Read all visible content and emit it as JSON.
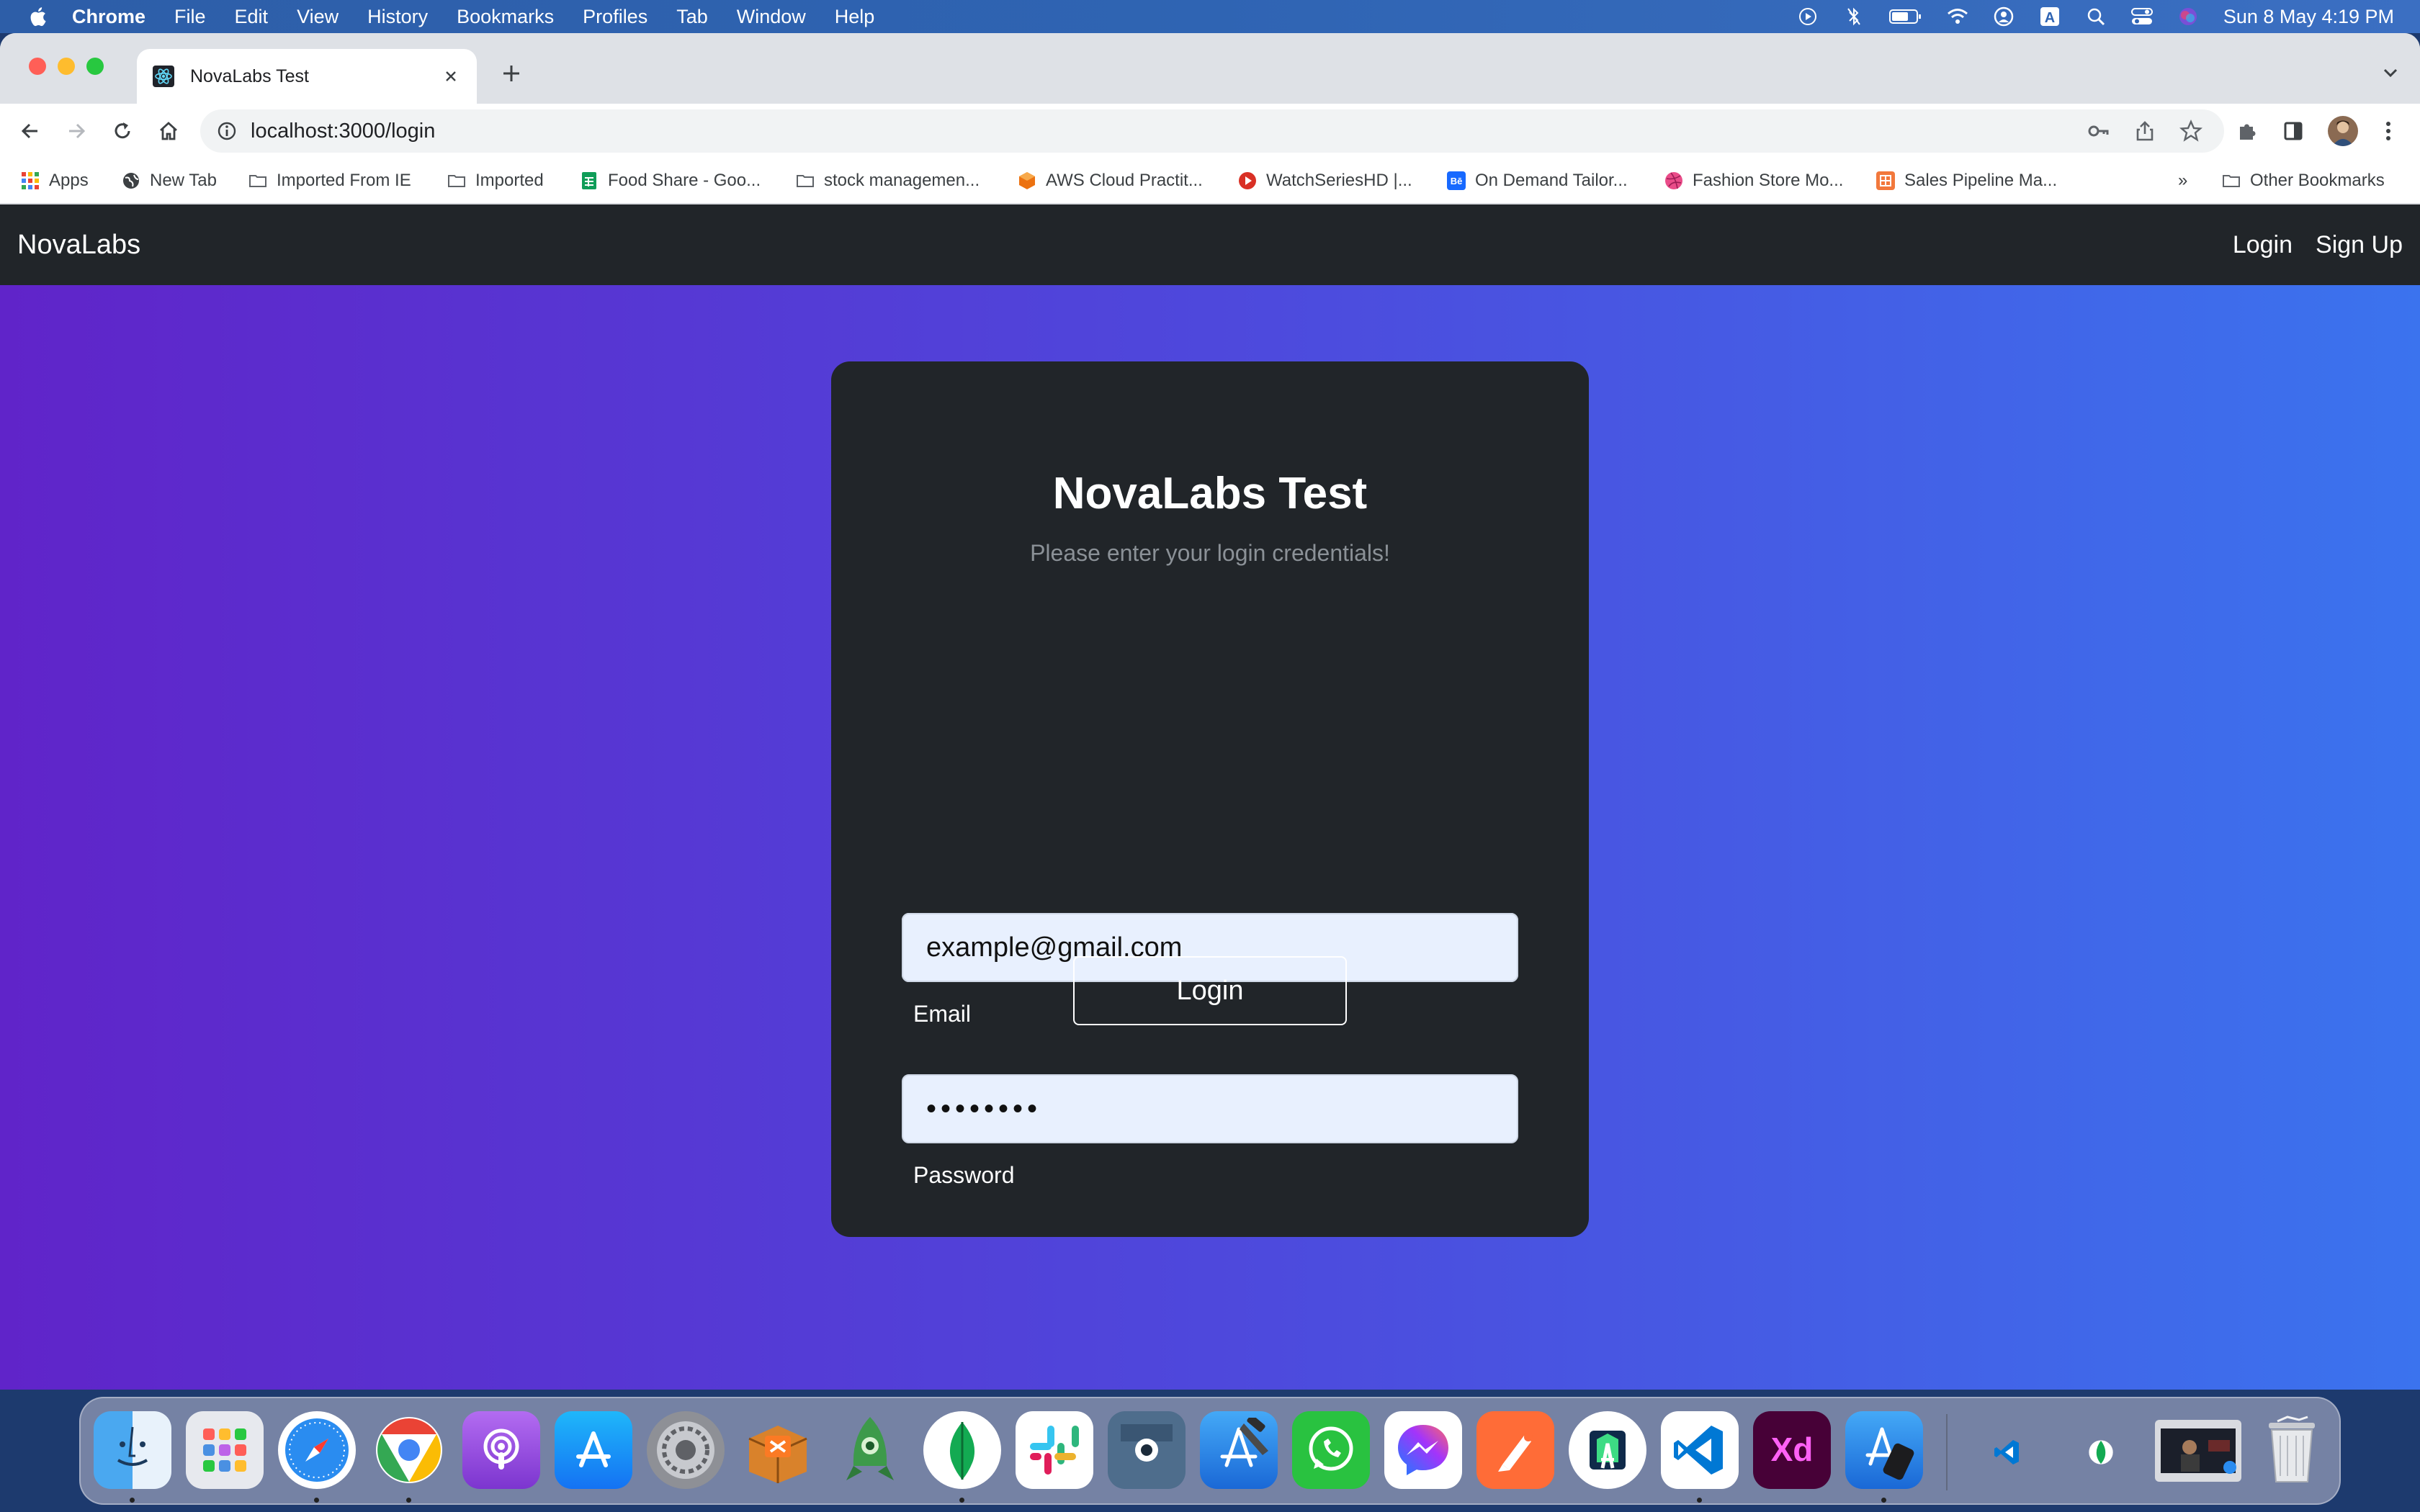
{
  "menubar": {
    "app_name": "Chrome",
    "items": [
      "File",
      "Edit",
      "View",
      "History",
      "Bookmarks",
      "Profiles",
      "Tab",
      "Window",
      "Help"
    ],
    "clock": "Sun 8 May  4:19 PM"
  },
  "browser": {
    "tab_title": "NovaLabs Test",
    "url": "localhost:3000/login",
    "bookmarks": [
      {
        "label": "Apps",
        "icon": "apps-grid-icon"
      },
      {
        "label": "New Tab",
        "icon": "globe-icon"
      },
      {
        "label": "Imported From IE",
        "icon": "folder-icon"
      },
      {
        "label": "Imported",
        "icon": "folder-icon"
      },
      {
        "label": "Food Share - Goo...",
        "icon": "sheets-icon"
      },
      {
        "label": "stock managemen...",
        "icon": "folder-icon"
      },
      {
        "label": "AWS Cloud Practit...",
        "icon": "aws-icon"
      },
      {
        "label": "WatchSeriesHD |...",
        "icon": "play-icon"
      },
      {
        "label": "On Demand Tailor...",
        "icon": "behance-icon"
      },
      {
        "label": "Fashion Store Mo...",
        "icon": "dribbble-icon"
      },
      {
        "label": "Sales Pipeline Ma...",
        "icon": "template-icon"
      }
    ],
    "overflow": "»",
    "other_bookmarks": "Other Bookmarks"
  },
  "page": {
    "brand": "NovaLabs",
    "nav": {
      "login": "Login",
      "signup": "Sign Up"
    },
    "card": {
      "title": "NovaLabs Test",
      "subtitle": "Please enter your login credentials!",
      "email_value": "example@gmail.com",
      "email_label": "Email",
      "password_value": "••••••••",
      "password_label": "Password",
      "login_button": "Login"
    }
  },
  "colors": {
    "navbar": "#212529",
    "gradient_start": "#6024c9",
    "gradient_end": "#3b73ee",
    "card": "#212529",
    "input_bg": "#e8f0fe"
  },
  "dock_apps": [
    "finder",
    "launchpad",
    "safari",
    "chrome",
    "podcasts",
    "app-store",
    "system-preferences",
    "xampp",
    "robo-3t",
    "mongodb-compass",
    "slack",
    "mirror-app",
    "xcode",
    "whatsapp",
    "messenger",
    "postman",
    "android-studio",
    "vscode",
    "adobe-xd",
    "simulator"
  ]
}
